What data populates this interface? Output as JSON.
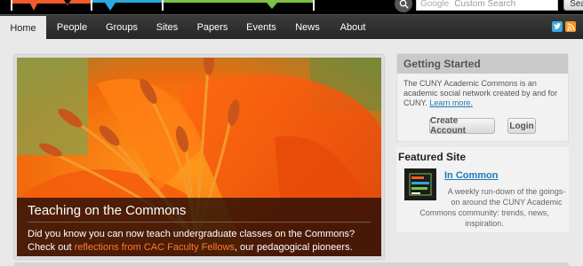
{
  "search": {
    "google_label": "Google",
    "placeholder": "Custom Search",
    "button_label": "Search"
  },
  "nav": {
    "items": [
      {
        "label": "Home",
        "active": true
      },
      {
        "label": "People"
      },
      {
        "label": "Groups"
      },
      {
        "label": "Sites"
      },
      {
        "label": "Papers"
      },
      {
        "label": "Events"
      },
      {
        "label": "News"
      },
      {
        "label": "About"
      }
    ],
    "icons": [
      "twitter-icon",
      "rss-icon"
    ]
  },
  "feature": {
    "title": "Teaching on the Commons",
    "text_before": "Did you know you can now teach undergraduate classes on the Commons? Check out ",
    "link_text": "reflections from CAC Faculty Fellows",
    "text_after": ", our pedagogical pioneers."
  },
  "getting_started": {
    "title": "Getting Started",
    "text": "The CUNY Academic Commons is an academic social network created by and for CUNY. ",
    "link": "Learn more.",
    "create_account": "Create Account",
    "login": "Login"
  },
  "featured_site": {
    "heading": "Featured Site",
    "thumb_text": "CUNY Academic Commons",
    "name": "In Common",
    "desc_line1": "A weekly run-down of the goings-on around the CUNY Academic",
    "desc_line2": "Commons community: trends, news, inspiration."
  },
  "colors": {
    "nav_bg": "#2c2c2c",
    "link": "#1f7ab8",
    "accent_orange": "#ff7a2c",
    "panel_title_bg": "#c9c9c9"
  }
}
